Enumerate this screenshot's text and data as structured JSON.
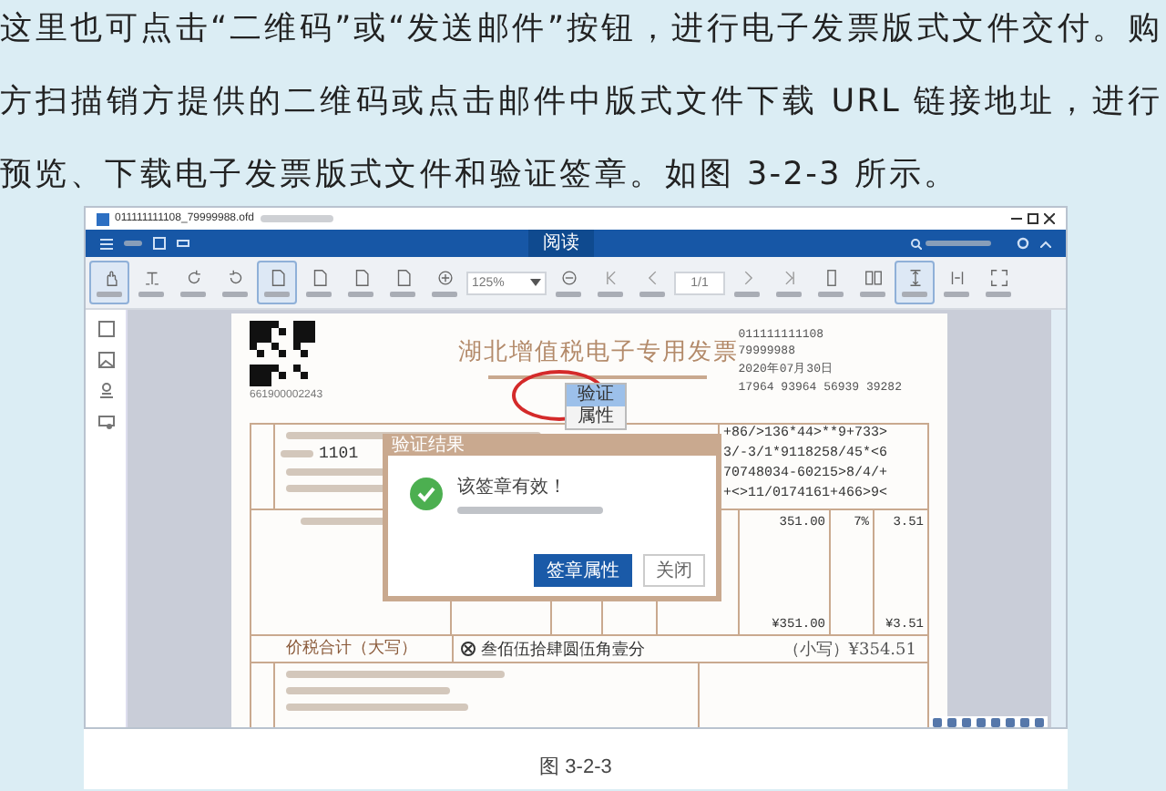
{
  "article": {
    "paragraph": "这里也可点击“二维码”或“发送邮件”按钮，进行电子发票版式文件交付。购方扫描销方提供的二维码或点击邮件中版式文件下载 URL 链接地址，进行预览、下载电子发票版式文件和验证签章。如图 3-2-3 所示。",
    "caption": "图 3-2-3"
  },
  "viewer": {
    "title": "011111111108_79999988.ofd",
    "mode_tab": "阅读",
    "toolbar": [
      {
        "kind": "hand",
        "selected": true
      },
      {
        "kind": "text",
        "selected": false
      },
      {
        "kind": "rotate-cw",
        "selected": false
      },
      {
        "kind": "rotate-ccw",
        "selected": false
      },
      {
        "kind": "page",
        "selected": true
      },
      {
        "kind": "page",
        "selected": false
      },
      {
        "kind": "page",
        "selected": false
      },
      {
        "kind": "page",
        "selected": false
      },
      {
        "kind": "zoom-in",
        "selected": false
      },
      {
        "kind": "zoom-field",
        "value": "125%"
      },
      {
        "kind": "zoom-out",
        "selected": false
      },
      {
        "kind": "first",
        "selected": false
      },
      {
        "kind": "prev",
        "selected": false
      },
      {
        "kind": "page-field",
        "value": "1/1"
      },
      {
        "kind": "next",
        "selected": false
      },
      {
        "kind": "last",
        "selected": false
      },
      {
        "kind": "single",
        "selected": false
      },
      {
        "kind": "double",
        "selected": false
      },
      {
        "kind": "continuous",
        "selected": true
      },
      {
        "kind": "double-cont",
        "selected": false
      },
      {
        "kind": "fullscreen",
        "selected": false
      }
    ]
  },
  "invoice": {
    "title": "湖北增值税电子专用发票",
    "codes": [
      "011111111108",
      "79999988",
      "2020年07月30日",
      "17964 93964 56939 39282"
    ],
    "machine_no": "661900002243",
    "buyer_tax_id": "1101",
    "cipher": [
      "+86/>136*44>**9+733>",
      "3/-3/1*9118258/45*<6",
      "70748034-60215>8/4/+",
      "+<>11/0174161+466>9<"
    ],
    "amount": "351.00",
    "rate": "7%",
    "tax": "3.51",
    "total_amount": "¥351.00",
    "total_tax": "¥3.51",
    "total_words_label": "价税合计（大写）",
    "total_words": "叁佰伍拾肆圆伍角壹分",
    "total_figures": "（小写）¥354.51"
  },
  "context_menu": [
    {
      "label": "验证",
      "selected": true
    },
    {
      "label": "属性",
      "selected": false
    }
  ],
  "dialog": {
    "title": "验证结果",
    "message": "该签章有效！",
    "buttons": [
      {
        "label": "签章属性",
        "kind": "primary"
      },
      {
        "label": "关闭",
        "kind": "secondary"
      }
    ]
  }
}
